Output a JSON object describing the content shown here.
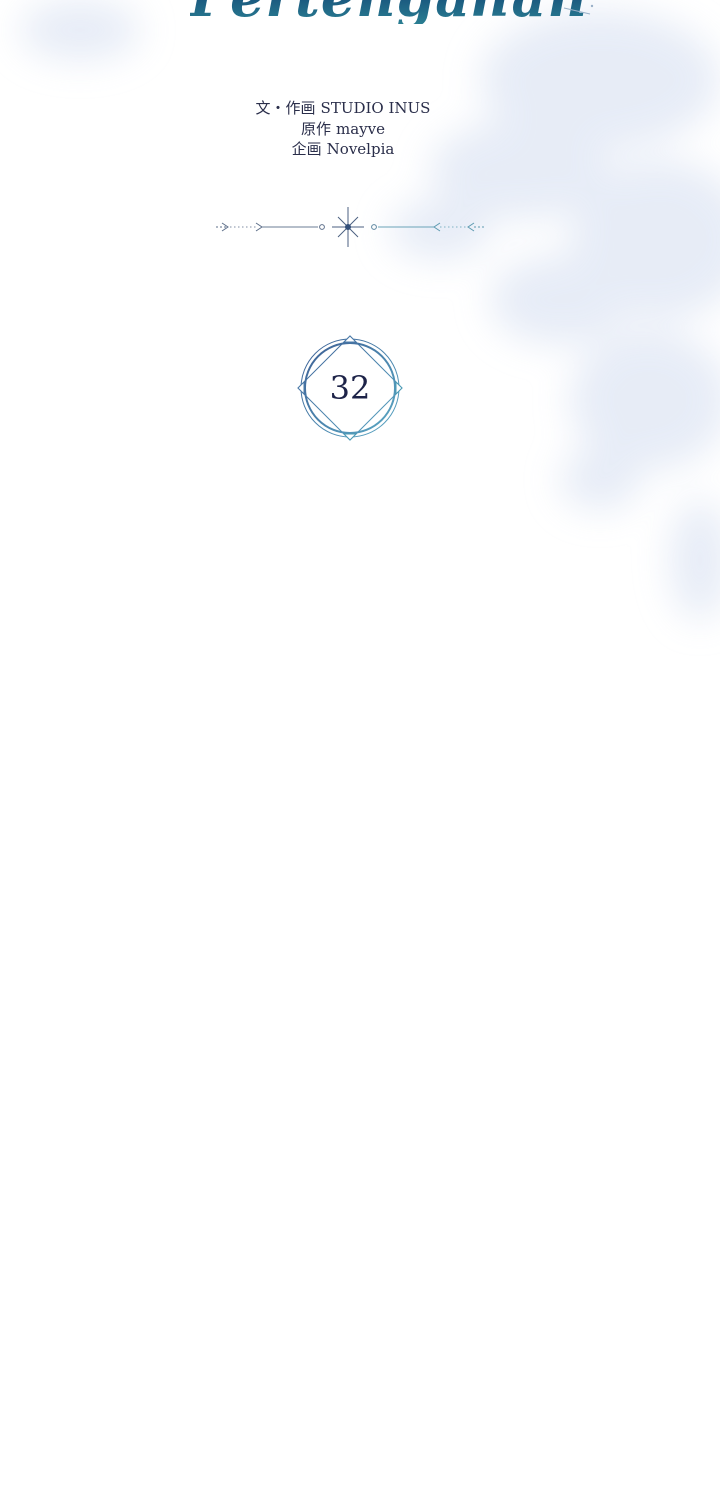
{
  "title": {
    "text": "Pertengahan"
  },
  "credits": [
    {
      "role": "文・作画",
      "name": "STUDIO INUS"
    },
    {
      "role": "原作",
      "name": "mayve"
    },
    {
      "role": "企画",
      "name": "Novelpia"
    }
  ],
  "chapter": {
    "number": "32"
  },
  "colors": {
    "title_dark": "#0f2e55",
    "title_teal": "#2a7e92",
    "credit_text": "#2a2e4a",
    "badge_ring": "#4a86b5",
    "background": "#ffffff",
    "bg_tint": "#e4ebf6"
  }
}
